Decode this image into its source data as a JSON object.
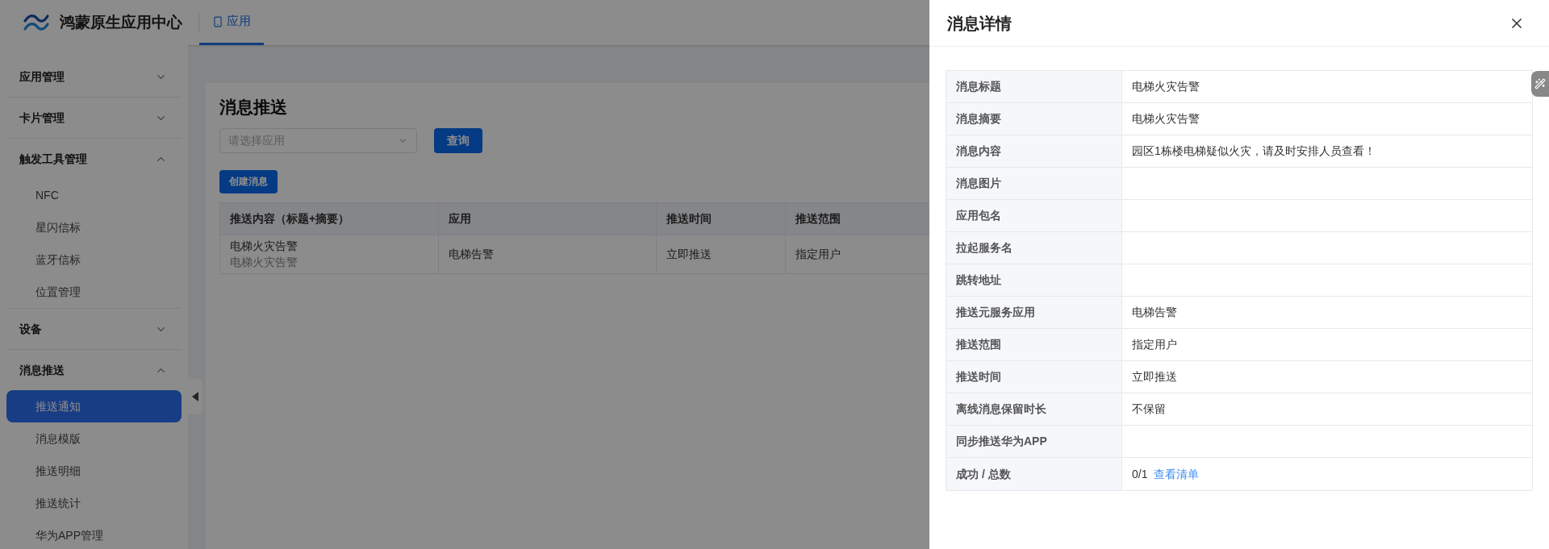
{
  "header": {
    "logo_text": "鸿蒙原生应用中心",
    "nav_tabs": [
      {
        "label": "应用",
        "selected": true
      }
    ]
  },
  "sidebar": {
    "groups": [
      {
        "label": "应用管理",
        "expanded": false
      },
      {
        "label": "卡片管理",
        "expanded": false
      },
      {
        "label": "触发工具管理",
        "expanded": true,
        "children": [
          {
            "label": "NFC",
            "selected": false
          },
          {
            "label": "星闪信标",
            "selected": false
          },
          {
            "label": "蓝牙信标",
            "selected": false
          },
          {
            "label": "位置管理",
            "selected": false
          }
        ]
      },
      {
        "label": "设备",
        "expanded": false
      },
      {
        "label": "消息推送",
        "expanded": true,
        "children": [
          {
            "label": "推送通知",
            "selected": true
          },
          {
            "label": "消息模版",
            "selected": false
          },
          {
            "label": "推送明细",
            "selected": false
          },
          {
            "label": "推送统计",
            "selected": false
          },
          {
            "label": "华为APP管理",
            "selected": false
          }
        ]
      }
    ]
  },
  "main": {
    "title": "消息推送",
    "app_select": {
      "placeholder": "请选择应用"
    },
    "query_button": "查询",
    "create_button": "创建消息",
    "table": {
      "columns": [
        "推送内容（标题+摘要）",
        "应用",
        "推送时间",
        "推送范围"
      ],
      "rows": [
        {
          "title": "电梯火灾告警",
          "summary": "电梯火灾告警",
          "app": "电梯告警",
          "push_time": "立即推送",
          "push_scope": "指定用户"
        }
      ]
    }
  },
  "drawer": {
    "title": "消息详情",
    "fields": [
      {
        "label": "消息标题",
        "value": "电梯火灾告警"
      },
      {
        "label": "消息摘要",
        "value": "电梯火灾告警"
      },
      {
        "label": "消息内容",
        "value": "园区1栋楼电梯疑似火灾，请及时安排人员查看！"
      },
      {
        "label": "消息图片"
      },
      {
        "label": "应用包名"
      },
      {
        "label": "拉起服务名"
      },
      {
        "label": "跳转地址"
      },
      {
        "label": "推送元服务应用",
        "value": "电梯告警"
      },
      {
        "label": "推送范围",
        "value": "指定用户"
      },
      {
        "label": "推送时间",
        "value": "立即推送"
      },
      {
        "label": "离线消息保留时长",
        "value": "不保留"
      },
      {
        "label": "同步推送华为APP"
      },
      {
        "label": "成功 / 总数",
        "value": "0/1",
        "link": "查看清单"
      }
    ]
  }
}
